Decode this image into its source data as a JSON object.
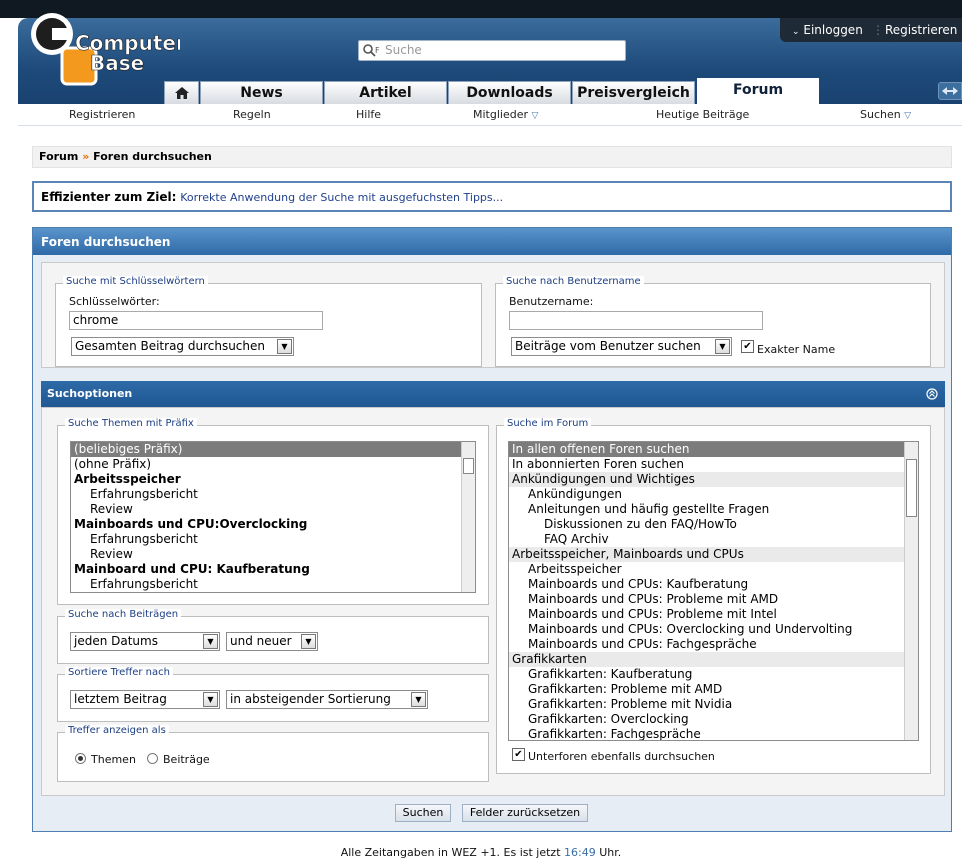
{
  "header": {
    "logo_line1": "Computer",
    "logo_line2": "Base",
    "search_placeholder": "Suche",
    "login": "Einloggen",
    "register": "Registrieren"
  },
  "tabs": [
    "News",
    "Artikel",
    "Downloads",
    "Preisvergleich",
    "Forum"
  ],
  "active_tab": "Forum",
  "subnav": [
    "Registrieren",
    "Regeln",
    "Hilfe",
    "Mitglieder",
    "Heutige Beiträge",
    "Suchen"
  ],
  "breadcrumb": {
    "root": "Forum",
    "sep": "»",
    "current": "Foren durchsuchen"
  },
  "notice": {
    "label": "Effizienter zum Ziel:",
    "link": "Korrekte Anwendung der Suche mit ausgefuchsten Tipps..."
  },
  "main_title": "Foren durchsuchen",
  "keywords": {
    "legend": "Suche mit Schlüsselwörtern",
    "label": "Schlüsselwörter:",
    "value": "chrome",
    "scope": "Gesamten Beitrag durchsuchen"
  },
  "username": {
    "legend": "Suche nach Benutzername",
    "label": "Benutzername:",
    "value": "",
    "mode": "Beiträge vom Benutzer suchen",
    "exact_label": "Exakter Name",
    "exact_checked": true
  },
  "options_title": "Suchoptionen",
  "prefix": {
    "legend": "Suche Themen mit Präfix",
    "items": [
      {
        "text": "(beliebiges Präfix)",
        "level": 0,
        "style": "selected"
      },
      {
        "text": "(ohne Präfix)",
        "level": 0,
        "style": ""
      },
      {
        "text": "Arbeitsspeicher",
        "level": 0,
        "style": "bold"
      },
      {
        "text": "Erfahrungsbericht",
        "level": 1,
        "style": ""
      },
      {
        "text": "Review",
        "level": 1,
        "style": ""
      },
      {
        "text": "Mainboards und CPU:Overclocking",
        "level": 0,
        "style": "bold"
      },
      {
        "text": "Erfahrungsbericht",
        "level": 1,
        "style": ""
      },
      {
        "text": "Review",
        "level": 1,
        "style": ""
      },
      {
        "text": "Mainboard und CPU: Kaufberatung",
        "level": 0,
        "style": "bold"
      },
      {
        "text": "Erfahrungsbericht",
        "level": 1,
        "style": ""
      }
    ]
  },
  "posts": {
    "legend": "Suche nach Beiträgen",
    "date": "jeden Datums",
    "direction": "und neuer"
  },
  "sort": {
    "legend": "Sortiere Treffer nach",
    "by": "letztem Beitrag",
    "order": "in absteigender Sortierung"
  },
  "display": {
    "legend": "Treffer anzeigen als",
    "opt1": "Themen",
    "opt2": "Beiträge",
    "selected": "Themen"
  },
  "forums": {
    "legend": "Suche im Forum",
    "items": [
      {
        "text": "In allen offenen Foren suchen",
        "level": 0,
        "style": "selected"
      },
      {
        "text": "In abonnierten Foren suchen",
        "level": 0,
        "style": ""
      },
      {
        "text": "Ankündigungen und Wichtiges",
        "level": 0,
        "style": "group"
      },
      {
        "text": "Ankündigungen",
        "level": 1,
        "style": ""
      },
      {
        "text": "Anleitungen und häufig gestellte Fragen",
        "level": 1,
        "style": ""
      },
      {
        "text": "Diskussionen zu den FAQ/HowTo",
        "level": 2,
        "style": ""
      },
      {
        "text": "FAQ Archiv",
        "level": 2,
        "style": ""
      },
      {
        "text": "Arbeitsspeicher, Mainboards und CPUs",
        "level": 0,
        "style": "group"
      },
      {
        "text": "Arbeitsspeicher",
        "level": 1,
        "style": ""
      },
      {
        "text": "Mainboards und CPUs: Kaufberatung",
        "level": 1,
        "style": ""
      },
      {
        "text": "Mainboards und CPUs: Probleme mit AMD",
        "level": 1,
        "style": ""
      },
      {
        "text": "Mainboards und CPUs: Probleme mit Intel",
        "level": 1,
        "style": ""
      },
      {
        "text": "Mainboards und CPUs: Overclocking und Undervolting",
        "level": 1,
        "style": ""
      },
      {
        "text": "Mainboards und CPUs: Fachgespräche",
        "level": 1,
        "style": ""
      },
      {
        "text": "Grafikkarten",
        "level": 0,
        "style": "group"
      },
      {
        "text": "Grafikkarten: Kaufberatung",
        "level": 1,
        "style": ""
      },
      {
        "text": "Grafikkarten: Probleme mit AMD",
        "level": 1,
        "style": ""
      },
      {
        "text": "Grafikkarten: Probleme mit Nvidia",
        "level": 1,
        "style": ""
      },
      {
        "text": "Grafikkarten: Overclocking",
        "level": 1,
        "style": ""
      },
      {
        "text": "Grafikkarten: Fachgespräche",
        "level": 1,
        "style": ""
      }
    ],
    "subforums_label": "Unterforen ebenfalls durchsuchen",
    "subforums_checked": true
  },
  "buttons": {
    "search": "Suchen",
    "reset": "Felder zurücksetzen"
  },
  "footer": {
    "prefix": "Alle Zeitangaben in WEZ +1. Es ist jetzt",
    "time": "16:49",
    "suffix": "Uhr."
  },
  "colors": {
    "accent": "#2e6aa7",
    "header": "#1d4a7a",
    "breadcrumb_sep": "#e07000"
  }
}
